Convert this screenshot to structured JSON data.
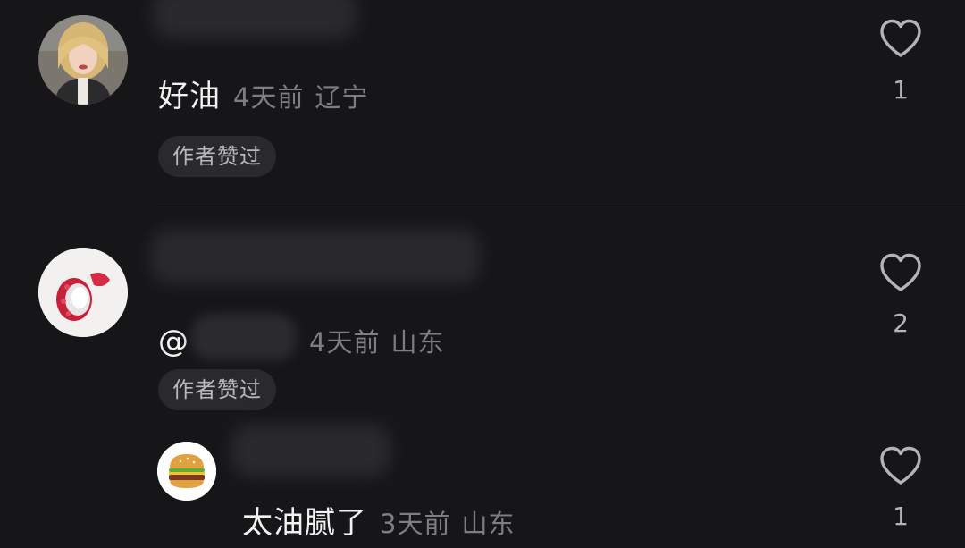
{
  "comments": [
    {
      "text": "好油",
      "time": "4天前",
      "location": "辽宁",
      "badge": "作者赞过",
      "like_count": "1",
      "avatar_icon": "user-photo-avatar"
    },
    {
      "text": "@",
      "time": "4天前",
      "location": "山东",
      "badge": "作者赞过",
      "like_count": "2",
      "avatar_icon": "lychee-avatar"
    },
    {
      "text": "太油腻了",
      "time": "3天前",
      "location": "山东",
      "like_count": "1",
      "avatar_icon": "burger-emoji-avatar"
    }
  ],
  "colors": {
    "background": "#161619",
    "meta_text": "#7d7d83",
    "badge_bg": "#2a2a2e"
  }
}
